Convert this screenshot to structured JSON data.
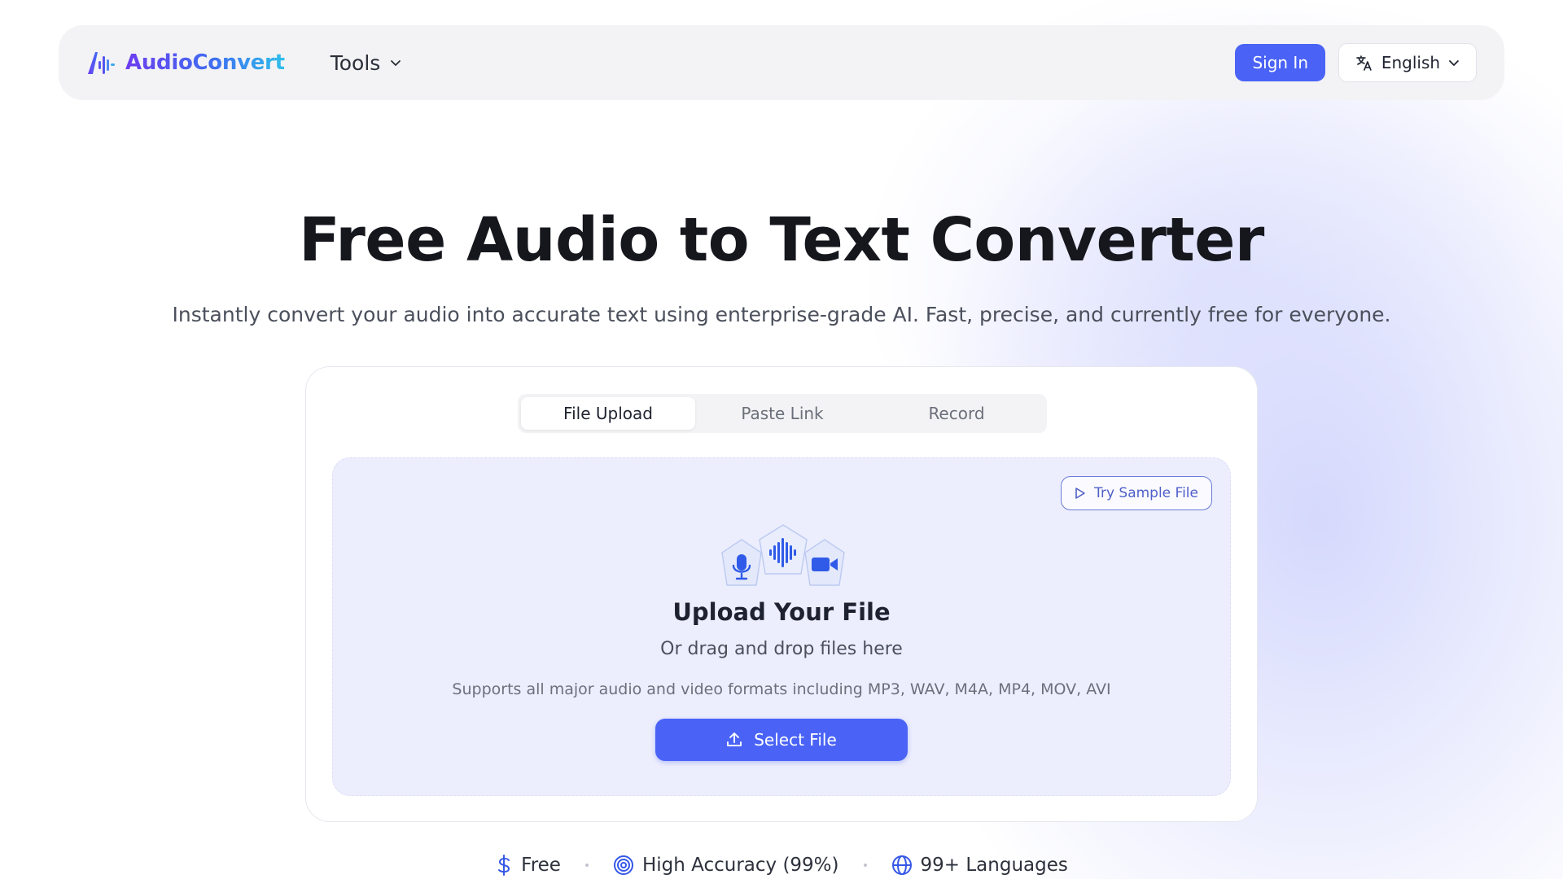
{
  "nav": {
    "logo_text": "AudioConvert",
    "tools_label": "Tools",
    "signin_label": "Sign In",
    "language_label": "English"
  },
  "hero": {
    "title": "Free Audio to Text Converter",
    "subtitle": "Instantly convert your audio into accurate text using enterprise-grade AI. Fast, precise, and currently free for everyone."
  },
  "tabs": [
    {
      "label": "File Upload",
      "active": true
    },
    {
      "label": "Paste Link",
      "active": false
    },
    {
      "label": "Record",
      "active": false
    }
  ],
  "upload": {
    "sample_label": "Try Sample File",
    "title": "Upload Your File",
    "subtitle": "Or drag and drop files here",
    "formats": "Supports all major audio and video formats including MP3, WAV, M4A, MP4, MOV, AVI",
    "select_label": "Select File"
  },
  "features": [
    {
      "label": "Free",
      "icon": "dollar-icon"
    },
    {
      "label": "High Accuracy (99%)",
      "icon": "target-icon"
    },
    {
      "label": "99+ Languages",
      "icon": "globe-icon"
    }
  ],
  "colors": {
    "accent": "#4a63f6",
    "dropzone_bg": "#eceefd",
    "nav_bg": "#f3f3f5"
  }
}
